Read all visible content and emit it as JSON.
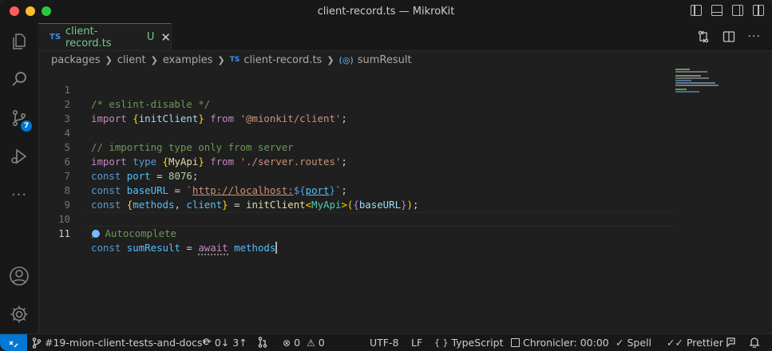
{
  "window": {
    "title": "client-record.ts — MikroKit"
  },
  "activity_bar": {
    "scm_badge": "7"
  },
  "tab": {
    "type_badge": "TS",
    "filename": "client-record.ts",
    "status": "U",
    "close": "✕"
  },
  "breadcrumbs": {
    "items": [
      "packages",
      "client",
      "examples",
      "client-record.ts",
      "sumResult"
    ],
    "ts_badge": "TS"
  },
  "editor": {
    "line_numbers": [
      "1",
      "2",
      "3",
      "4",
      "5",
      "6",
      "7",
      "8",
      "9",
      "10",
      "11"
    ],
    "active_line": "11",
    "code": {
      "l1_comment": "/* eslint-disable */",
      "l2_import": "import",
      "l2_brace_open": "{",
      "l2_ident": "initClient",
      "l2_brace_close": "}",
      "l2_from": "from",
      "l2_str": "'@mionkit/client'",
      "l2_semi": ";",
      "l4_comment": "// importing type only from server",
      "l5_import": "import",
      "l5_type": "type",
      "l5_brace_open": "{",
      "l5_ident": "MyApi",
      "l5_brace_close": "}",
      "l5_from": "from",
      "l5_str": "'./server.routes'",
      "l5_semi": ";",
      "l6_const": "const",
      "l6_ident": "port",
      "l6_eq": "=",
      "l6_num": "8076",
      "l6_semi": ";",
      "l7_const": "const",
      "l7_ident": "baseURL",
      "l7_eq": "=",
      "l7_tick": "`",
      "l7_url": "http://localhost:",
      "l7_interp_open": "${",
      "l7_interp_var": "port",
      "l7_interp_close": "}",
      "l7_tick_close": "`",
      "l7_semi": ";",
      "l8_const": "const",
      "l8_brace_open": "{",
      "l8_methods": "methods",
      "l8_comma": ",",
      "l8_client": "client",
      "l8_brace_close": "}",
      "l8_eq": "=",
      "l8_fn": "initClient",
      "l8_lt": "<",
      "l8_type": "MyApi",
      "l8_gt": ">",
      "l8_paren_open": "(",
      "l8_inner_brace_open": "{",
      "l8_arg": "baseURL",
      "l8_inner_brace_close": "}",
      "l8_paren_close": ")",
      "l8_semi": ";",
      "l10_comment": "Autocomplete",
      "l10_slash": "/",
      "l11_const": "const",
      "l11_ident": "sumResult",
      "l11_eq": "=",
      "l11_await": "await",
      "l11_methods": "methods"
    }
  },
  "status_bar": {
    "branch": "#19-mion-client-tests-and-docs*",
    "sync": "0↓ 3↑",
    "errors": "0",
    "warnings": "0",
    "encoding": "UTF-8",
    "eol": "LF",
    "language": "TypeScript",
    "language_braces": "{ }",
    "chronicler": "Chronicler: 00:00",
    "spell": "Spell",
    "prettier": "Prettier"
  },
  "colors": {
    "accent": "#0078d4",
    "tab_modified": "#73c991",
    "background": "#1f1f1f"
  }
}
